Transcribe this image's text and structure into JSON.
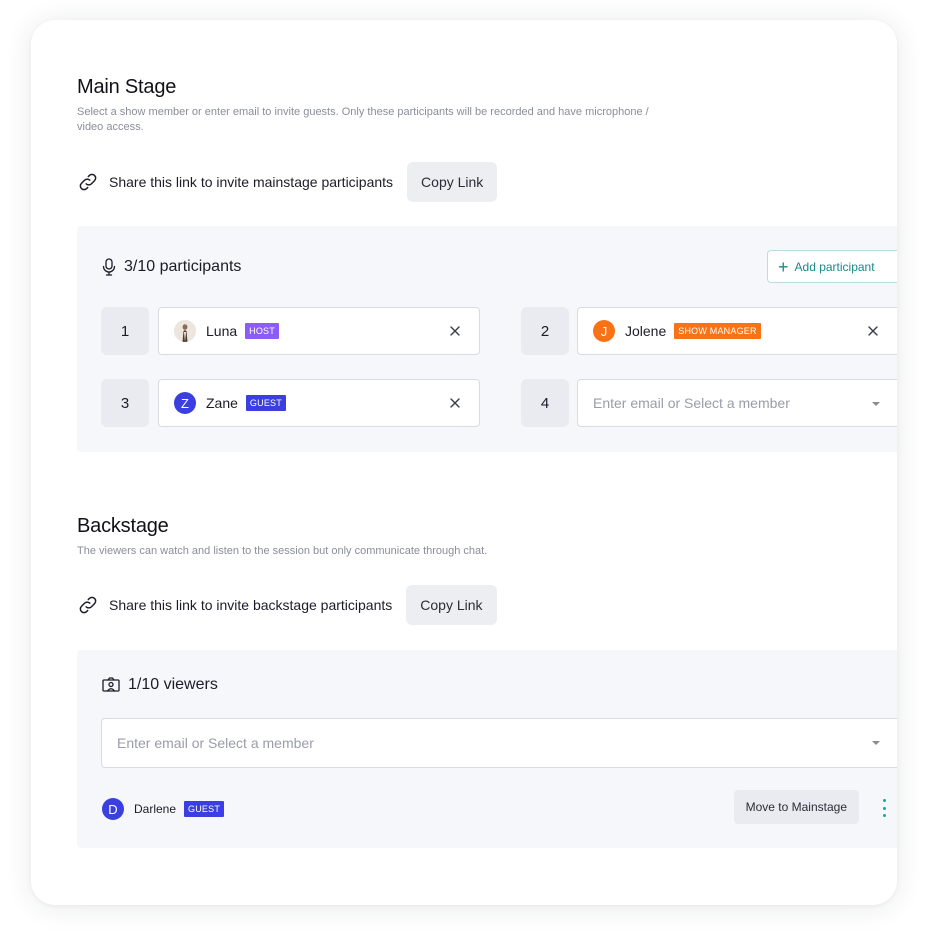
{
  "main_stage": {
    "title": "Main Stage",
    "description": "Select a show member or enter email to invite guests. Only these participants will be recorded and have microphone / video access.",
    "share_text": "Share this link to invite mainstage participants",
    "copy_label": "Copy Link",
    "participants_count": "3/10 participants",
    "add_participant_label": "Add participant",
    "slots": [
      {
        "number": "1",
        "name": "Luna",
        "badge": "HOST",
        "badge_color": "#8b5cf6",
        "avatar": "photo"
      },
      {
        "number": "2",
        "name": "Jolene",
        "badge": "SHOW MANAGER",
        "badge_color": "#f97316",
        "avatar_letter": "J",
        "avatar_color": "#f97316"
      },
      {
        "number": "3",
        "name": "Zane",
        "badge": "GUEST",
        "badge_color": "#3b3fe0",
        "avatar_letter": "Z",
        "avatar_color": "#3b3fe0"
      },
      {
        "number": "4",
        "placeholder": "Enter email or Select a member"
      }
    ]
  },
  "backstage": {
    "title": "Backstage",
    "description": "The viewers can watch and listen to the session but only communicate through chat.",
    "share_text": "Share this link to invite backstage participants",
    "copy_label": "Copy Link",
    "viewers_count": "1/10 viewers",
    "select_placeholder": "Enter email or Select a member",
    "viewers": [
      {
        "avatar_letter": "D",
        "avatar_color": "#3b3fe0",
        "name": "Darlene",
        "badge": "GUEST",
        "badge_color": "#3b3fe0",
        "action_label": "Move to Mainstage"
      }
    ]
  },
  "colors": {
    "accent_teal": "#178a87",
    "panel_bg": "#f6f7fb"
  }
}
